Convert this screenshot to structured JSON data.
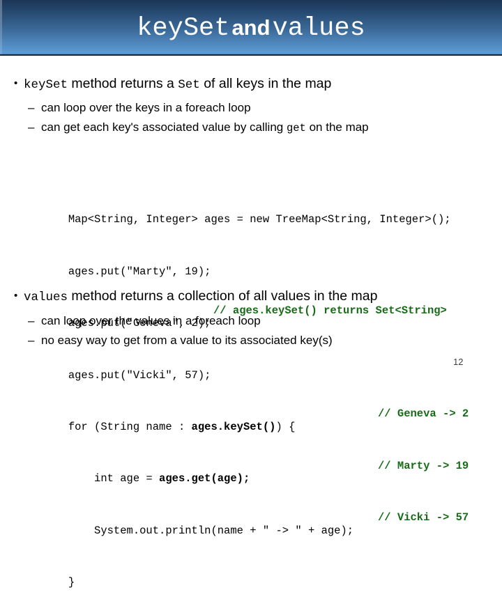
{
  "slide": {
    "title": {
      "part_mono_1": "keySet",
      "part_and": "and",
      "part_mono_2": "values"
    },
    "page_number": "12",
    "accent_color": "#5c9bd4",
    "header_dark_color": "#1b3555",
    "comment_color": "#176b17"
  },
  "section_one": {
    "bullet_marker": "•",
    "lead_code": "keySet",
    "lead_text_a": " method returns a ",
    "lead_code_2": "Set",
    "lead_text_b": " of all keys in the map",
    "sub_bullets": [
      {
        "dash": "–",
        "text_a": "can loop over the keys in a foreach loop",
        "code": "",
        "text_b": ""
      },
      {
        "dash": "–",
        "text_a": "can get each key's associated value by calling ",
        "code": "get",
        "text_b": " on the map"
      }
    ]
  },
  "code": {
    "lines": [
      {
        "plain": "Map<String, Integer> ages = new TreeMap<String, Integer>();",
        "bold": "",
        "plain_tail": "",
        "comment": "",
        "comment_near": false
      },
      {
        "plain": "ages.put(\"Marty\", 19);",
        "bold": "",
        "plain_tail": "",
        "comment": "",
        "comment_near": false
      },
      {
        "plain": "ages.put(\"Geneva\", 2);",
        "bold": "",
        "plain_tail": "",
        "comment": "// ages.keySet() returns Set<String>",
        "comment_near": true
      },
      {
        "plain": "ages.put(\"Vicki\", 57);",
        "bold": "",
        "plain_tail": "",
        "comment": "",
        "comment_near": false
      },
      {
        "plain": "for (String name : ",
        "bold": "ages.keySet()",
        "plain_tail": ") {",
        "comment": "// Geneva -> 2",
        "comment_near": false
      },
      {
        "plain": "    int age = ",
        "bold": "ages.get(age);",
        "plain_tail": "",
        "comment": "// Marty -> 19",
        "comment_near": false
      },
      {
        "plain": "    System.out.println(name + \" -> \" + age);",
        "bold": "",
        "plain_tail": "",
        "comment": "// Vicki -> 57",
        "comment_near": false
      },
      {
        "plain": "}",
        "bold": "",
        "plain_tail": "",
        "comment": "",
        "comment_near": false
      }
    ]
  },
  "section_two": {
    "bullet_marker": "•",
    "lead_code": "values",
    "lead_text_a": " method returns a collection of all values in the map",
    "sub_bullets": [
      {
        "dash": "–",
        "text": "can loop over the values in a foreach loop"
      },
      {
        "dash": "–",
        "text": "no easy way to get from a value to its associated key(s)"
      }
    ]
  }
}
